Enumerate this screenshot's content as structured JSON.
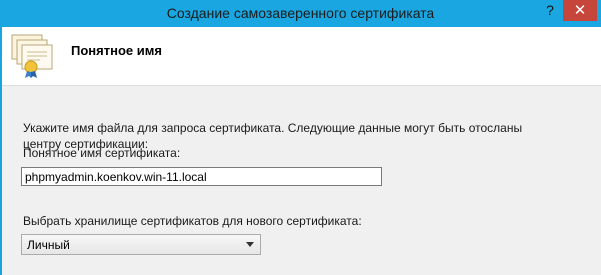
{
  "window": {
    "title": "Создание самозаверенного сертификата",
    "help_glyph": "?",
    "close_glyph": "✕"
  },
  "header": {
    "icon": "certificate-icon",
    "title": "Понятное имя"
  },
  "form": {
    "description": "Укажите имя файла для запроса сертификата. Следующие данные могут быть отосланы центру сертификации:",
    "name_label": "Понятное имя сертификата:",
    "name_value": "phpmyadmin.koenkov.win-11.local",
    "store_label": "Выбрать хранилище сертификатов для нового сертификата:",
    "store_value": "Личный"
  },
  "colors": {
    "titlebar": "#1aa7e1",
    "close_button": "#c7463c",
    "client_bg": "#f0f0f0"
  }
}
